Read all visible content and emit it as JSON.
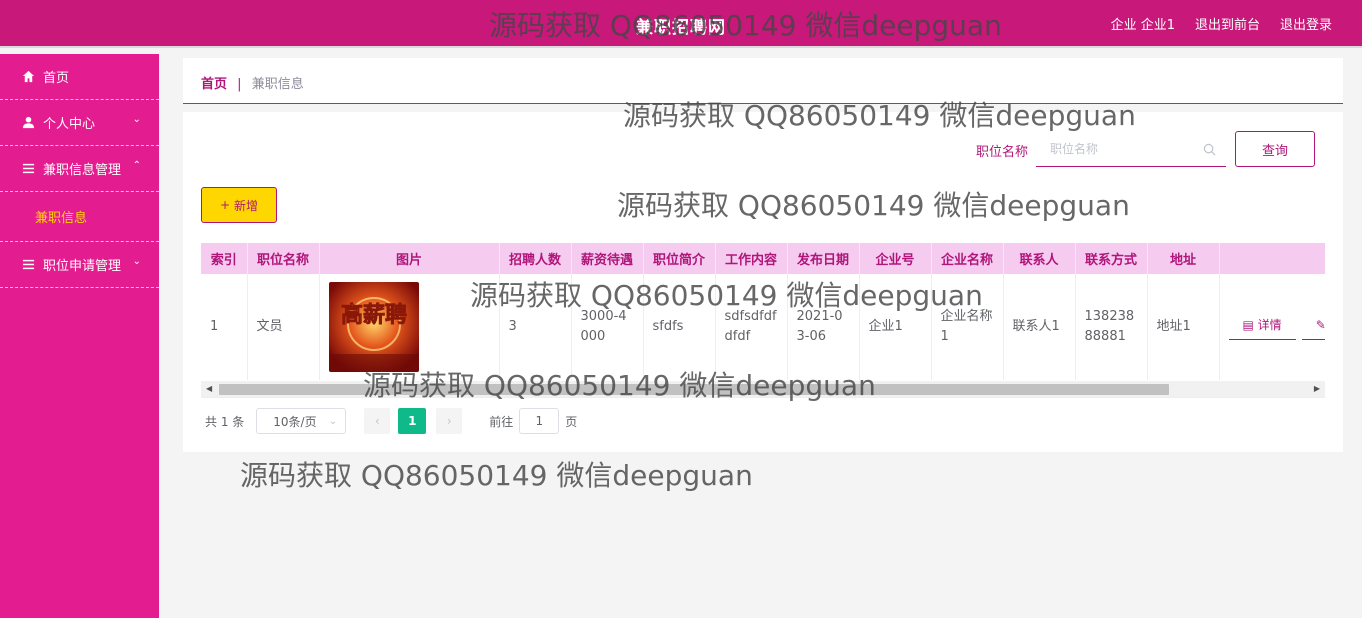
{
  "header": {
    "logo": "兼职招聘网",
    "user": "企业 企业1",
    "exit_frontend": "退出到前台",
    "logout": "退出登录"
  },
  "sidebar": {
    "items": [
      {
        "label": "首页",
        "icon": "home-icon"
      },
      {
        "label": "个人中心",
        "icon": "user-icon"
      },
      {
        "label": "兼职信息管理",
        "icon": "list-icon"
      },
      {
        "label": "职位申请管理",
        "icon": "list-icon"
      }
    ],
    "submenu": {
      "label": "兼职信息"
    }
  },
  "breadcrumb": {
    "home": "首页",
    "separator": "|",
    "current": "兼职信息"
  },
  "search": {
    "label": "职位名称",
    "placeholder": "职位名称",
    "button": "查询"
  },
  "add_button": "新增",
  "table": {
    "headers": [
      "索引",
      "职位名称",
      "图片",
      "招聘人数",
      "薪资待遇",
      "职位简介",
      "工作内容",
      "发布日期",
      "企业号",
      "企业名称",
      "联系人",
      "联系方式",
      "地址"
    ],
    "rows": [
      {
        "index": "1",
        "position": "文员",
        "image_text": "高薪聘",
        "recruit_count": "3",
        "salary": "3000-4000",
        "intro": "sfdfs",
        "content": "sdfsdfdfdfdf",
        "date": "2021-03-06",
        "company_no": "企业1",
        "company_name": "企业名称1",
        "contact": "联系人1",
        "phone": "13823888881",
        "address": "地址1",
        "detail_action": "详情"
      }
    ]
  },
  "pagination": {
    "total": "共 1 条",
    "page_size": "10条/页",
    "current_page": "1",
    "goto_label": "前往",
    "goto_value": "1",
    "page_unit": "页"
  },
  "watermark": "源码获取 QQ86050149 微信deepguan",
  "colors": {
    "primary": "#c8187a",
    "sidebar": "#e31d8f",
    "accent": "#ffd700",
    "table_header": "#f5cbf0",
    "active_page": "#10b98a"
  }
}
